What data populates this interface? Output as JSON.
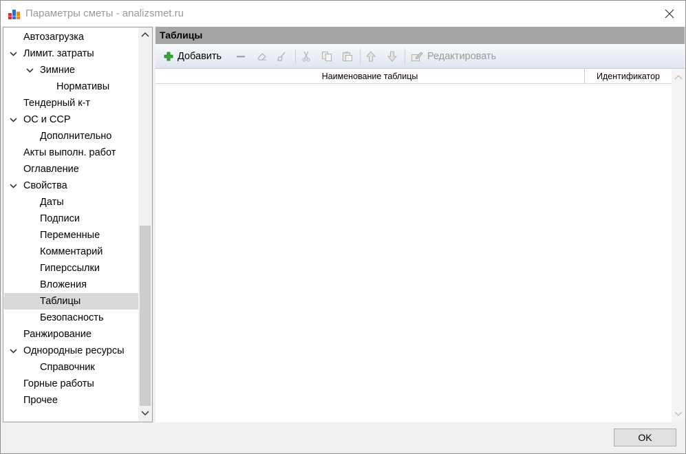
{
  "window": {
    "title": "Параметры сметы - analizsmet.ru"
  },
  "tree": {
    "items": [
      {
        "label": "Автозагрузка",
        "level": 0,
        "expandable": false
      },
      {
        "label": "Лимит. затраты",
        "level": 0,
        "expandable": true
      },
      {
        "label": "Зимние",
        "level": 1,
        "expandable": true
      },
      {
        "label": "Нормативы",
        "level": 2,
        "expandable": false
      },
      {
        "label": "Тендерный к-т",
        "level": 0,
        "expandable": false
      },
      {
        "label": "ОС и ССР",
        "level": 0,
        "expandable": true
      },
      {
        "label": "Дополнительно",
        "level": 1,
        "expandable": false
      },
      {
        "label": "Акты выполн. работ",
        "level": 0,
        "expandable": false
      },
      {
        "label": "Оглавление",
        "level": 0,
        "expandable": false
      },
      {
        "label": "Свойства",
        "level": 0,
        "expandable": true
      },
      {
        "label": "Даты",
        "level": 1,
        "expandable": false
      },
      {
        "label": "Подписи",
        "level": 1,
        "expandable": false
      },
      {
        "label": "Переменные",
        "level": 1,
        "expandable": false
      },
      {
        "label": "Комментарий",
        "level": 1,
        "expandable": false
      },
      {
        "label": "Гиперссылки",
        "level": 1,
        "expandable": false
      },
      {
        "label": "Вложения",
        "level": 1,
        "expandable": false
      },
      {
        "label": "Таблицы",
        "level": 1,
        "expandable": false,
        "selected": true
      },
      {
        "label": "Безопасность",
        "level": 1,
        "expandable": false
      },
      {
        "label": "Ранжирование",
        "level": 0,
        "expandable": false
      },
      {
        "label": "Однородные ресурсы",
        "level": 0,
        "expandable": true
      },
      {
        "label": "Справочник",
        "level": 1,
        "expandable": false
      },
      {
        "label": "Горные работы",
        "level": 0,
        "expandable": false
      },
      {
        "label": "Прочее",
        "level": 0,
        "expandable": false
      }
    ]
  },
  "panel": {
    "title": "Таблицы"
  },
  "toolbar": {
    "add_label": "Добавить",
    "edit_label": "Редактировать"
  },
  "grid": {
    "columns": [
      "Наименование таблицы",
      "Идентификатор"
    ],
    "rows": []
  },
  "footer": {
    "ok_label": "OK"
  },
  "colors": {
    "panel_header": "#a5a5a5",
    "selected_row": "#d9d9d9",
    "add_icon": "#2e9a2e"
  }
}
